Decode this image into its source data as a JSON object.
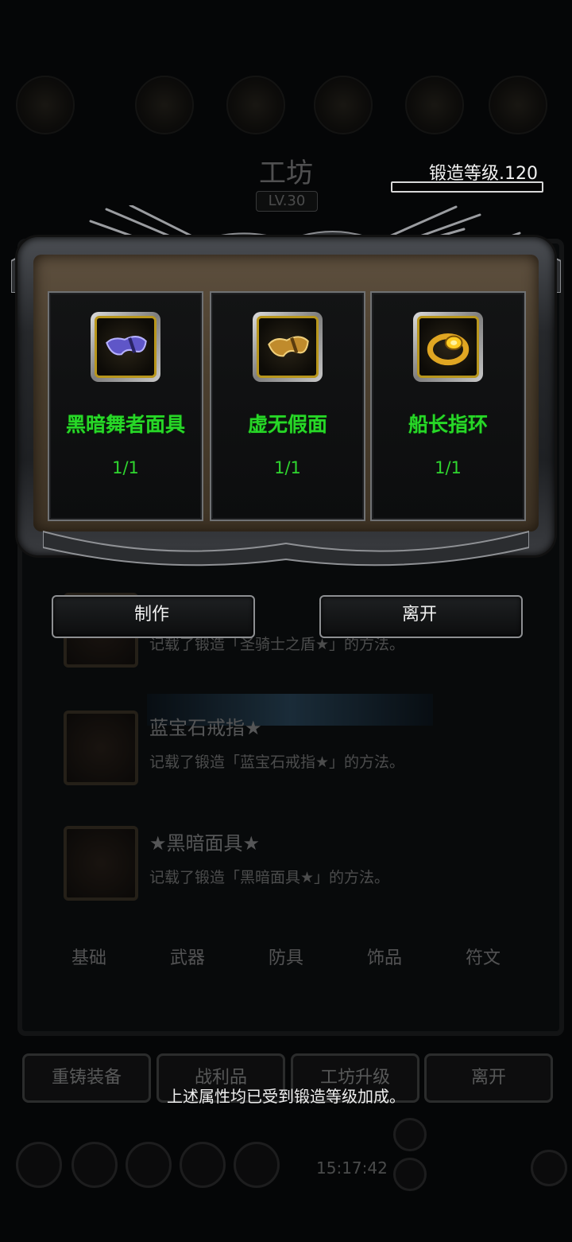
{
  "forge": {
    "level_text": "锻造等级.120"
  },
  "background": {
    "title": "工坊",
    "level_badge": "LV.30",
    "recipes": [
      {
        "name": "★",
        "desc": "记载了锻造「圣骑士之盾★」的方法。"
      },
      {
        "name": "蓝宝石戒指★",
        "desc": "记载了锻造「蓝宝石戒指★」的方法。"
      },
      {
        "name": "★黑暗面具★",
        "desc": "记载了锻造「黑暗面具★」的方法。"
      }
    ],
    "tabs": [
      "基础",
      "武器",
      "防具",
      "饰品",
      "符文"
    ],
    "buttons": [
      "重铸装备",
      "战利品",
      "工坊升级",
      "离开"
    ],
    "time": "15:17:42"
  },
  "dialog": {
    "items": [
      {
        "name": "黑暗舞者面具",
        "count": "1/1",
        "icon": "purple-mask-icon",
        "color": "#5f56c8"
      },
      {
        "name": "虚无假面",
        "count": "1/1",
        "icon": "gold-mask-icon",
        "color": "#c08b2c"
      },
      {
        "name": "船长指环",
        "count": "1/1",
        "icon": "gold-ring-icon",
        "color": "#e0a622"
      }
    ],
    "make_label": "制作",
    "leave_label": "离开"
  },
  "notice": "上述属性均已受到锻造等级加成。",
  "colors": {
    "item_name": "#27d827",
    "background": "#050607"
  }
}
